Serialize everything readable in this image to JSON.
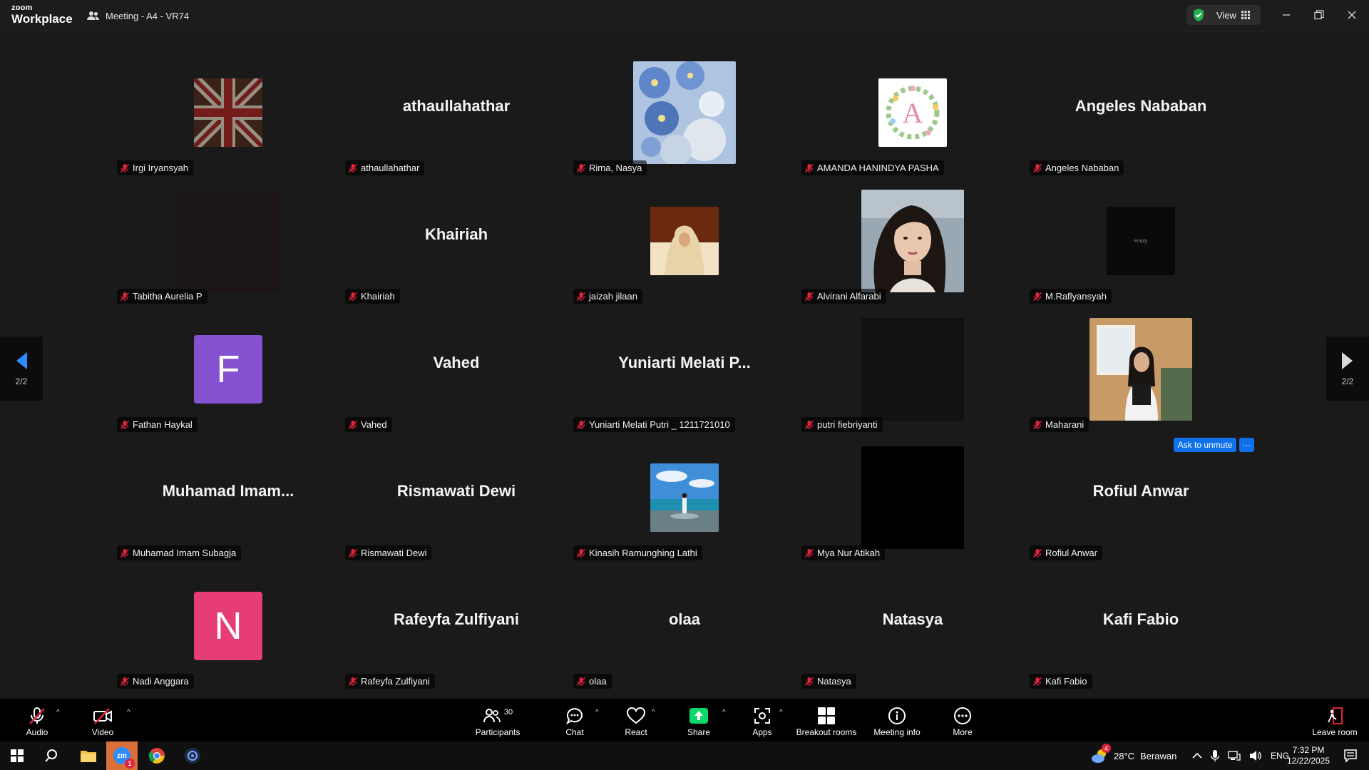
{
  "app": {
    "brand_top": "zoom",
    "brand_bottom": "Workplace",
    "meeting_title": "Meeting - A4 - VR74",
    "view_label": "View"
  },
  "page_indicator": {
    "left": "2/2",
    "right": "2/2"
  },
  "tiles": [
    {
      "name": "Irgi Iryansyah",
      "display": "image",
      "big": ""
    },
    {
      "name": "athaullahathar",
      "display": "name",
      "big": "athaullahathar"
    },
    {
      "name": "Rima, Nasya",
      "display": "image",
      "big": ""
    },
    {
      "name": "AMANDA HANINDYA PASHA",
      "display": "image",
      "big": ""
    },
    {
      "name": "Angeles Nababan",
      "display": "name",
      "big": "Angeles Nababan"
    },
    {
      "name": "Tabitha Aurelia P",
      "display": "image",
      "big": ""
    },
    {
      "name": "Khairiah",
      "display": "name",
      "big": "Khairiah"
    },
    {
      "name": "jaizah jilaan",
      "display": "image",
      "big": ""
    },
    {
      "name": "Alvirani Alfarabi",
      "display": "image",
      "big": ""
    },
    {
      "name": "M.Raflyansyah",
      "display": "image",
      "big": ""
    },
    {
      "name": "Fathan Haykal",
      "display": "letter",
      "big": "F"
    },
    {
      "name": "Vahed",
      "display": "name",
      "big": "Vahed"
    },
    {
      "name": "Yuniarti Melati Putri _ 1211721010",
      "display": "name",
      "big": "Yuniarti Melati P..."
    },
    {
      "name": "putri fiebriyanti",
      "display": "image",
      "big": ""
    },
    {
      "name": "Maharani",
      "display": "image",
      "big": ""
    },
    {
      "name": "Muhamad Imam Subagja",
      "display": "name",
      "big": "Muhamad  Imam..."
    },
    {
      "name": "Rismawati Dewi",
      "display": "name",
      "big": "Rismawati Dewi"
    },
    {
      "name": "Kinasih Ramunghing Lathi",
      "display": "image",
      "big": ""
    },
    {
      "name": "Mya Nur Atikah",
      "display": "image",
      "big": ""
    },
    {
      "name": "Rofiul Anwar",
      "display": "name",
      "big": "Rofiul Anwar"
    },
    {
      "name": "Nadi Anggara",
      "display": "letter",
      "big": "N"
    },
    {
      "name": "Rafeyfa Zulfiyani",
      "display": "name",
      "big": "Rafeyfa Zulfiyani"
    },
    {
      "name": "olaa",
      "display": "name",
      "big": "olaa"
    },
    {
      "name": "Natasya",
      "display": "name",
      "big": "Natasya"
    },
    {
      "name": "Kafi Fabio",
      "display": "name",
      "big": "Kafi Fabio"
    }
  ],
  "avatar_label_empty": "empty",
  "hover_actions": {
    "ask_unmute": "Ask to unmute",
    "more": "···"
  },
  "toolbar": {
    "audio": "Audio",
    "video": "Video",
    "participants": "Participants",
    "participants_count": "30",
    "chat": "Chat",
    "react": "React",
    "share": "Share",
    "apps": "Apps",
    "breakout": "Breakout rooms",
    "meeting_info": "Meeting info",
    "more": "More",
    "leave": "Leave room"
  },
  "taskbar": {
    "weather_temp": "28°C",
    "weather_text": "Berawan",
    "lang": "ENG",
    "time": "7:32 PM",
    "date": "12/22/2025",
    "zoom_badge": "1",
    "weather_badge": "4"
  },
  "colors": {
    "accent": "#0e71eb",
    "share_green": "#0ed86a",
    "muted_red": "#e0243a",
    "letter_f": "#8553d1",
    "letter_n": "#e63d74",
    "leave_red": "#e0243a"
  }
}
